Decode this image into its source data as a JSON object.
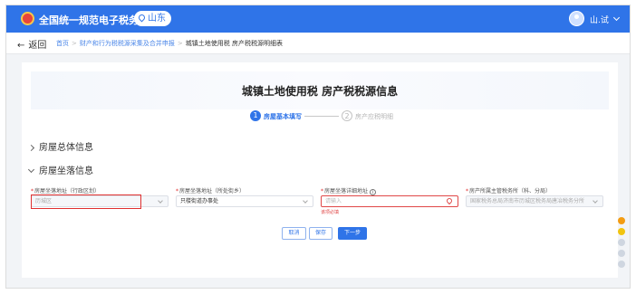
{
  "header": {
    "title": "全国统一规范电子税务局",
    "region": "山东",
    "username": "山.试",
    "colors": {
      "primary": "#2f74e8"
    }
  },
  "crumb": {
    "back_label": "返回",
    "items": [
      "首页",
      "财产和行为税税源采集及合并申报",
      "城镇土地使用税 房产税税源明细表"
    ]
  },
  "page": {
    "title": "城镇土地使用税 房产税税源信息",
    "steps": [
      {
        "num": "1",
        "label": "房屋基本填写",
        "active": true
      },
      {
        "num": "2",
        "label": "房产应税明细",
        "active": false
      }
    ]
  },
  "sections": {
    "overall": "房屋总体信息",
    "location": "房屋坐落信息"
  },
  "form": {
    "district": {
      "label": "房屋坐落地址（行政区划）",
      "value": "历城区",
      "state": "disabled"
    },
    "street": {
      "label": "房屋坐落地址（所处街乡）",
      "value": "只楼街道办事处"
    },
    "detail": {
      "label": "房屋坐落详细地址",
      "placeholder": "请输入",
      "error": "该项必填"
    },
    "bureau": {
      "label": "房产所属主管税务所（科、分局）",
      "value": "国家税务总局济南市历城区税务局唐冶税务分所",
      "state": "disabled"
    }
  },
  "buttons": {
    "cancel": "取消",
    "save": "保存",
    "next": "下一步"
  },
  "side_rail": {
    "colors": [
      "#f39c12",
      "#f1c40f",
      "#cfd6e0",
      "#cfd6e0",
      "#cfd6e0"
    ]
  }
}
